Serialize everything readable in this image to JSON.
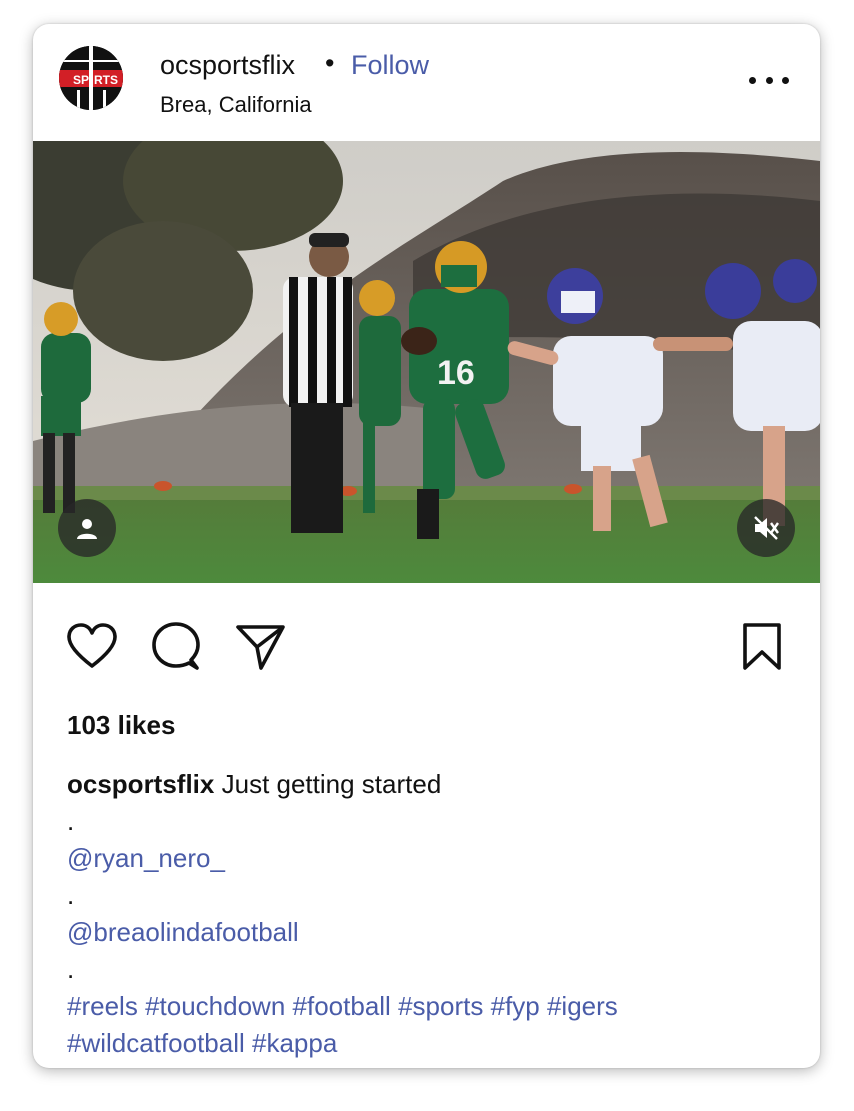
{
  "post": {
    "username": "ocsportsflix",
    "separator": "•",
    "follow_label": "Follow",
    "location": "Brea, California",
    "avatar_text_left": "SP",
    "avatar_text_right": "RTS",
    "likes": "103 likes",
    "caption_user": "ocsportsflix",
    "caption_text": "Just getting started",
    "caption_lines": [
      ".",
      "@ryan_nero_",
      ".",
      "@breaolindafootball",
      "."
    ],
    "hashtags_line1": [
      "#reels",
      "#touchdown",
      "#football",
      "#sports",
      "#fyp",
      "#igers"
    ],
    "hashtags_line2": [
      "#wildcatfootball",
      "#kappa"
    ]
  },
  "icons": {
    "more": "more-options-icon",
    "tag": "person-tag-icon",
    "mute": "muted-speaker-icon",
    "like": "heart-icon",
    "comment": "comment-bubble-icon",
    "share": "paper-plane-icon",
    "save": "bookmark-icon"
  },
  "colors": {
    "link": "#4a5ca8",
    "text": "#111111",
    "avatar_red": "#d21f26"
  }
}
